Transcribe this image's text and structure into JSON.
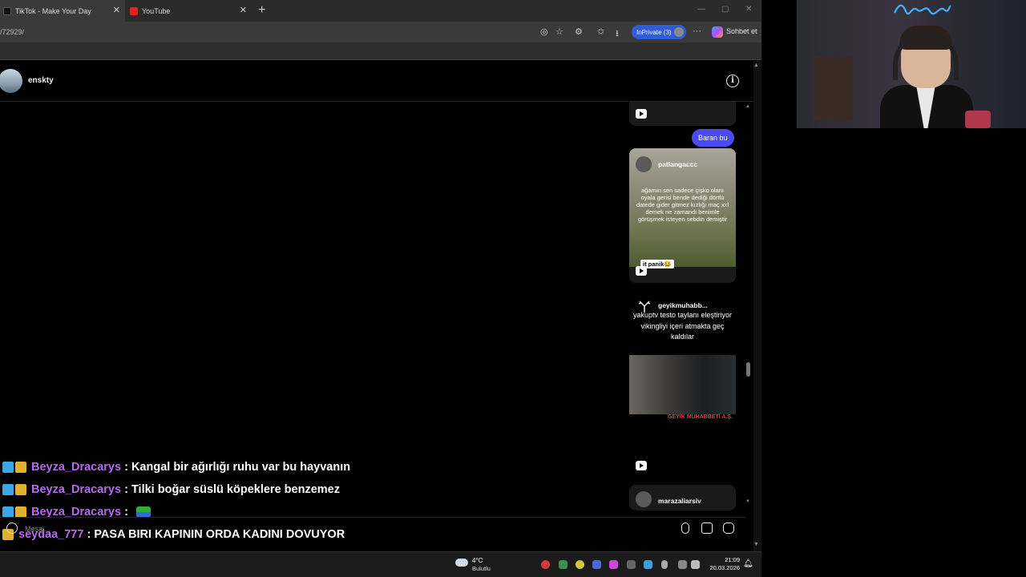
{
  "browser": {
    "tabs": [
      {
        "title": "TikTok - Make Your Day",
        "icon": "tiktok-icon"
      },
      {
        "title": "YouTube",
        "icon": "youtube-icon"
      }
    ],
    "new_tab": "+",
    "url": "/72929/",
    "inprivate_label": "InPrivate (3)",
    "copilot_label": "Sohbet et",
    "more_label": "···"
  },
  "dm": {
    "username": "enskty",
    "info_label": "i"
  },
  "messages": {
    "sent_bubble": "Baran bu",
    "card1": {
      "user": "patlangaccc",
      "text": "ağamın sen sadece çişko olanı oyala gerisi bende dediği dörtlü datede gider gitmez kızlığı maç xxl demek ne zamandı benimle görüşmek isteyen sebdin demiştir",
      "tag": "it panik😂"
    },
    "card2": {
      "user": "geyikmuhabb...",
      "text": "yakuptv testo taylanı eleştiriyor vikingliyi içeri atmakta geç kaldılar",
      "logo": "GEYİK MUHABBETİ A.Ş."
    },
    "card3": {
      "user": "marazaliarsiv"
    }
  },
  "chat": [
    {
      "user": "Beyza_Dracarys",
      "sep": " : ",
      "text": "Kangal bir ağırlığı ruhu var bu hayvanın"
    },
    {
      "user": "Beyza_Dracarys",
      "sep": " : ",
      "text": "Tilki boğar süslü köpeklere benzemez"
    },
    {
      "user": "Beyza_Dracarys",
      "sep": " : ",
      "text": ""
    },
    {
      "user": "seydaa_777",
      "sep": " : ",
      "text": "PASA BIRI KAPININ ORDA KADINI DOVUYOR"
    }
  ],
  "composer": {
    "placeholder": "Mesaj..."
  },
  "taskbar": {
    "temp": "4°C",
    "weather": "Bulutlu",
    "time": "21:09",
    "date": "20.03.2026"
  }
}
